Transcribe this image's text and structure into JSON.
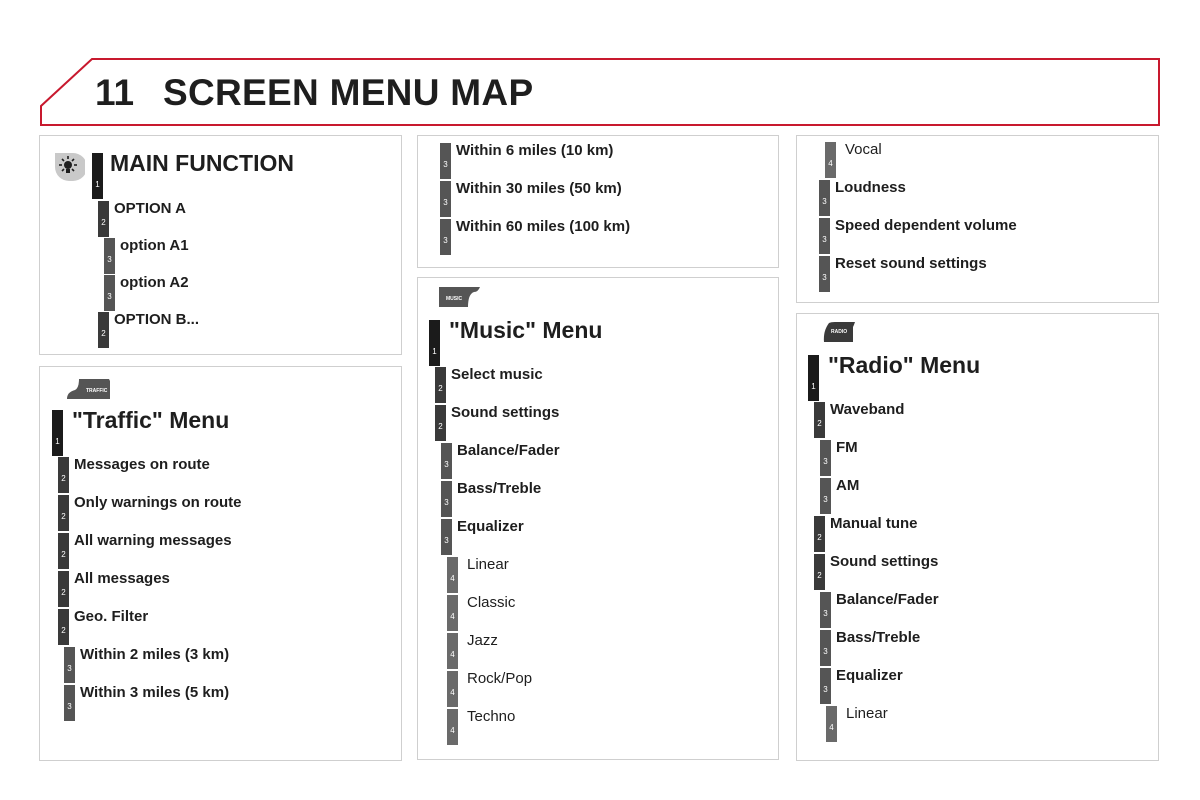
{
  "header": {
    "chapter_number": "11",
    "title": "SCREEN MENU MAP",
    "accent_color": "#c8192e"
  },
  "legend_panel": {
    "icon": "light-bulb-settings-icon",
    "items": [
      {
        "level": "1",
        "label": "MAIN FUNCTION"
      },
      {
        "level": "2",
        "label": "OPTION A"
      },
      {
        "level": "3",
        "label": "option A1"
      },
      {
        "level": "3",
        "label": "option A2"
      },
      {
        "level": "2",
        "label": "OPTION B..."
      }
    ]
  },
  "traffic_panel": {
    "icon_label": "TRAFFIC",
    "items": [
      {
        "level": "1",
        "label": "\"Traffic\" Menu"
      },
      {
        "level": "2",
        "label": "Messages on route"
      },
      {
        "level": "2",
        "label": "Only warnings on route"
      },
      {
        "level": "2",
        "label": "All warning messages"
      },
      {
        "level": "2",
        "label": "All messages"
      },
      {
        "level": "2",
        "label": "Geo. Filter"
      },
      {
        "level": "3",
        "label": "Within 2 miles (3 km)"
      },
      {
        "level": "3",
        "label": "Within 3 miles (5 km)"
      }
    ]
  },
  "traffic_cont_panel": {
    "items": [
      {
        "level": "3",
        "label": "Within 6 miles (10 km)"
      },
      {
        "level": "3",
        "label": "Within 30 miles (50 km)"
      },
      {
        "level": "3",
        "label": "Within 60 miles (100 km)"
      }
    ]
  },
  "music_panel": {
    "icon_label": "MUSIC",
    "items": [
      {
        "level": "1",
        "label": "\"Music\" Menu"
      },
      {
        "level": "2",
        "label": "Select music"
      },
      {
        "level": "2",
        "label": "Sound settings"
      },
      {
        "level": "3",
        "label": "Balance/Fader"
      },
      {
        "level": "3",
        "label": "Bass/Treble"
      },
      {
        "level": "3",
        "label": "Equalizer"
      },
      {
        "level": "4",
        "label": "Linear"
      },
      {
        "level": "4",
        "label": "Classic"
      },
      {
        "level": "4",
        "label": "Jazz"
      },
      {
        "level": "4",
        "label": "Rock/Pop"
      },
      {
        "level": "4",
        "label": "Techno"
      }
    ]
  },
  "music_cont_panel": {
    "items": [
      {
        "level": "4",
        "label": "Vocal"
      },
      {
        "level": "3",
        "label": "Loudness"
      },
      {
        "level": "3",
        "label": "Speed dependent volume"
      },
      {
        "level": "3",
        "label": "Reset sound settings"
      }
    ]
  },
  "radio_panel": {
    "icon_label": "RADIO",
    "items": [
      {
        "level": "1",
        "label": "\"Radio\" Menu"
      },
      {
        "level": "2",
        "label": "Waveband"
      },
      {
        "level": "3",
        "label": "FM"
      },
      {
        "level": "3",
        "label": "AM"
      },
      {
        "level": "2",
        "label": "Manual tune"
      },
      {
        "level": "2",
        "label": "Sound settings"
      },
      {
        "level": "3",
        "label": "Balance/Fader"
      },
      {
        "level": "3",
        "label": "Bass/Treble"
      },
      {
        "level": "3",
        "label": "Equalizer"
      },
      {
        "level": "4",
        "label": "Linear"
      }
    ]
  }
}
